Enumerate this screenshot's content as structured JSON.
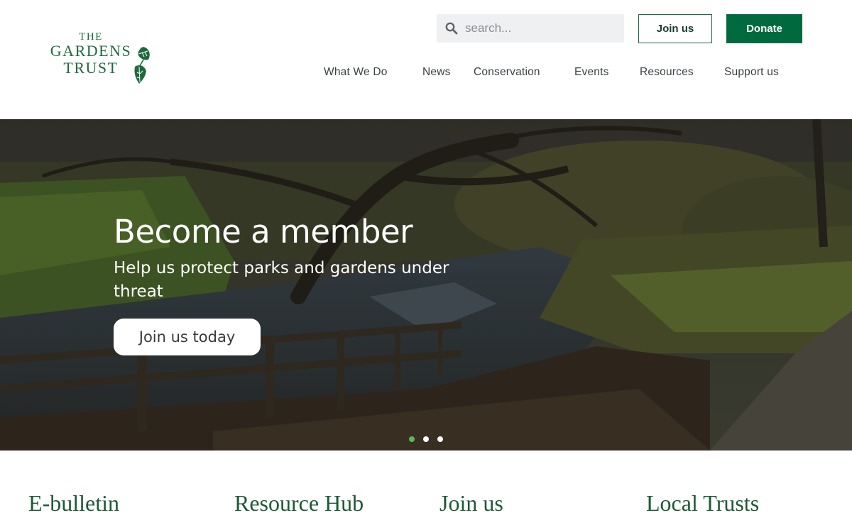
{
  "brand": {
    "logo_line1": "THE",
    "logo_line2": "GARDENS",
    "logo_line3": "TRUST",
    "color_primary": "#006a3e"
  },
  "search": {
    "placeholder": "search...",
    "icon": "search-icon"
  },
  "header_buttons": {
    "join": "Join us",
    "donate": "Donate"
  },
  "nav": {
    "items": [
      "What We Do",
      "News",
      "Conservation",
      "Events",
      "Resources",
      "Support us"
    ]
  },
  "hero": {
    "title": "Become a member",
    "subtitle": "Help us protect parks and gardens under threat",
    "cta": "Join us today",
    "slides_total": 3,
    "active_slide": 1,
    "dot_active_color": "#5cb85c"
  },
  "cards": {
    "titles": [
      "E-bulletin",
      "Resource Hub",
      "Join us",
      "Local Trusts"
    ]
  }
}
